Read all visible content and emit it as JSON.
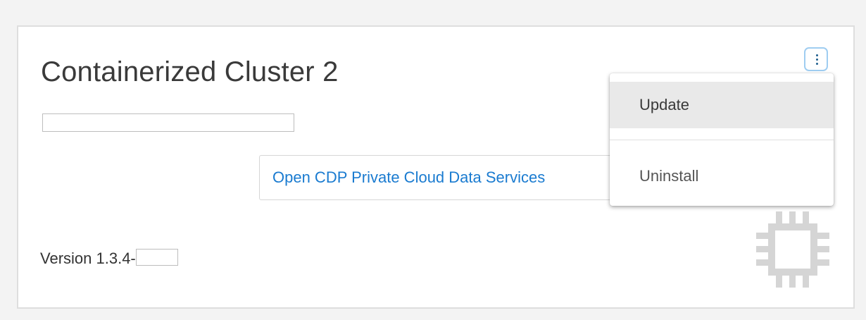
{
  "card": {
    "title": "Containerized Cluster 2",
    "open_link_label": "Open CDP Private Cloud Data Services",
    "version_label": "Version 1.3.4-"
  },
  "actions_menu": {
    "button_icon": "kebab-vertical-icon",
    "items": [
      {
        "label": "Update",
        "highlighted": true
      },
      {
        "label": "Uninstall",
        "highlighted": false
      }
    ]
  },
  "decoration": {
    "icon": "chip-icon"
  },
  "colors": {
    "link": "#1a7bd0",
    "menu_highlight": "#e9e9e9",
    "button_focus_border": "#9fcdf1",
    "chip_icon": "#d5d5d5"
  }
}
